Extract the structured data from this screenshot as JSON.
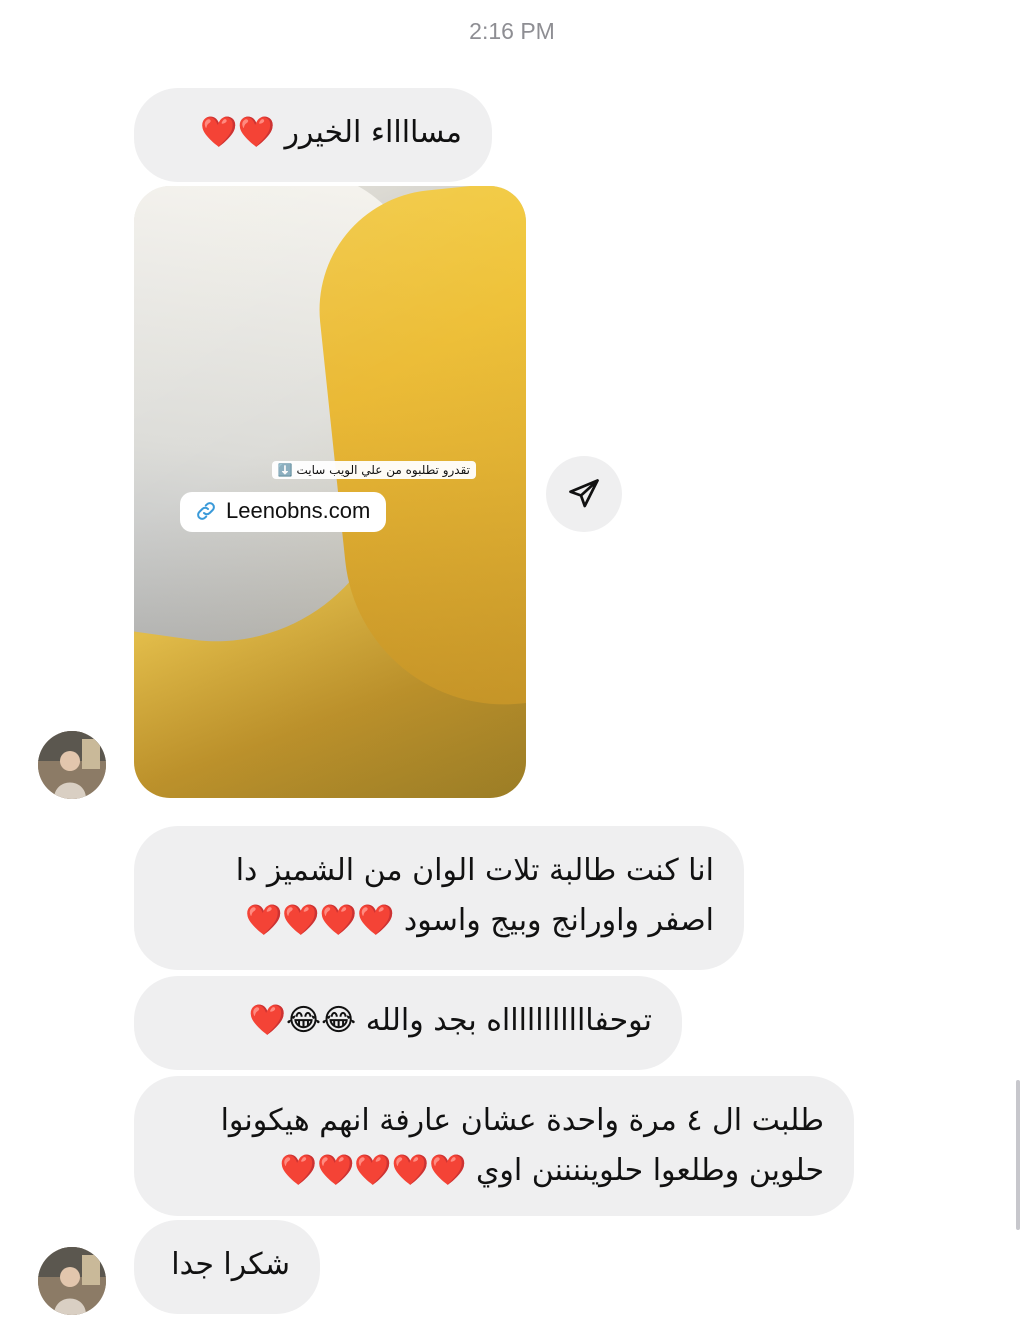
{
  "timestamp": "2:16 PM",
  "messages": [
    {
      "lines": [
        "مسااااء الخيرر ❤️❤️"
      ]
    },
    {
      "media": {
        "caption": "تقدرو تطلبوه من علي الويب سايت ⬇️",
        "link_text": "Leenobns.com"
      }
    },
    {
      "lines": [
        "انا كنت طالبة تلات الوان من الشميز دا",
        "اصفر واورانج وبيج واسود ❤️❤️❤️❤️"
      ]
    },
    {
      "lines": [
        "توحفاااااااااااه بجد والله 😂😂❤️"
      ]
    },
    {
      "lines": [
        "طلبت ال ٤ مرة واحدة عشان عارفة انهم هيكونوا",
        "حلوين وطلعوا حلويننننن اوي ❤️❤️❤️❤️❤️"
      ]
    },
    {
      "lines": [
        "شكرا جدا"
      ]
    }
  ],
  "icons": {
    "share": "share-icon",
    "link": "link-icon",
    "avatar": "avatar"
  },
  "colors": {
    "bubble": "#efeff0",
    "heart": "#e5252f",
    "timestamp": "#8e8e93"
  }
}
